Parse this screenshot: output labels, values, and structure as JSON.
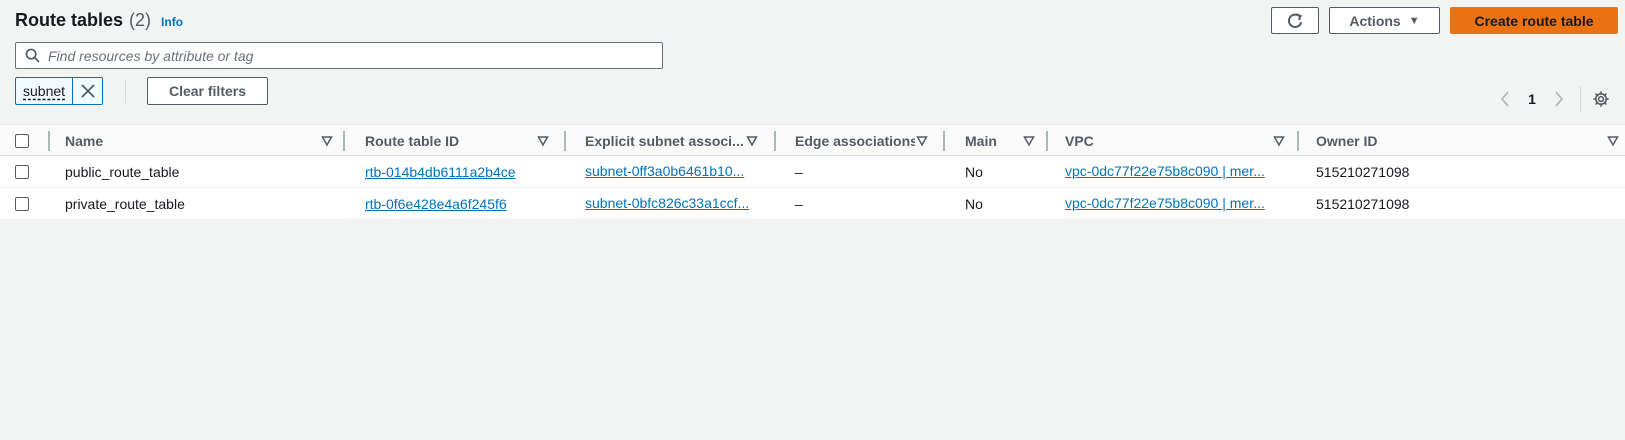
{
  "header": {
    "title": "Route tables",
    "count": "(2)",
    "info": "Info"
  },
  "toolbar": {
    "refresh_icon": "refresh-icon",
    "actions_label": "Actions",
    "create_label": "Create route table"
  },
  "search": {
    "placeholder": "Find resources by attribute or tag",
    "value": ""
  },
  "filter": {
    "token_label": "subnet",
    "clear_label": "Clear filters"
  },
  "pagination": {
    "current_page": "1"
  },
  "table": {
    "columns": [
      "Name",
      "Route table ID",
      "Explicit subnet associ...",
      "Edge associations",
      "Main",
      "VPC",
      "Owner ID"
    ],
    "rows": [
      {
        "name": "public_route_table",
        "route_table_id": "rtb-014b4db6111a2b4ce",
        "subnet": "subnet-0ff3a0b6461b10...",
        "edge": "–",
        "main": "No",
        "vpc": "vpc-0dc77f22e75b8c090 | mer...",
        "owner": "515210271098"
      },
      {
        "name": "private_route_table",
        "route_table_id": "rtb-0f6e428e4a6f245f6",
        "subnet": "subnet-0bfc826c33a1ccf...",
        "edge": "–",
        "main": "No",
        "vpc": "vpc-0dc77f22e75b8c090 | mer...",
        "owner": "515210271098"
      }
    ]
  },
  "colors": {
    "accent": "#0073bb",
    "primary_button": "#ec7211",
    "background": "#f2f3f3"
  }
}
